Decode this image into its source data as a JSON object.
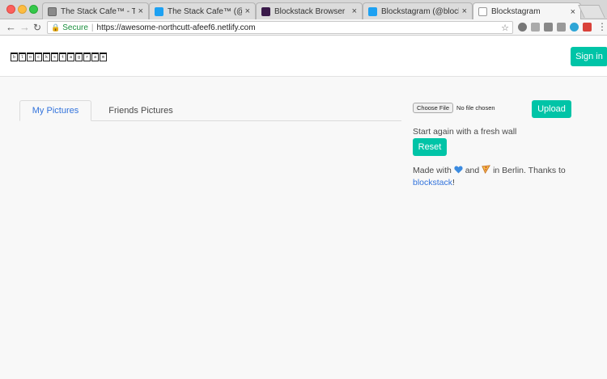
{
  "browser": {
    "tabs": [
      {
        "title": "The Stack Cafe™ - The Stac",
        "icon": "stack-cafe-icon"
      },
      {
        "title": "The Stack Cafe™ (@Grid_di",
        "icon": "twitter-icon"
      },
      {
        "title": "Blockstack Browser",
        "icon": "blockstack-icon"
      },
      {
        "title": "Blockstagram (@blockstagr",
        "icon": "twitter-icon"
      },
      {
        "title": "Blockstagram",
        "icon": "page-icon"
      }
    ],
    "close_glyph": "×",
    "address": {
      "secure_label": "Secure",
      "url": "https://awesome-northcutt-afeef6.netlify.com"
    }
  },
  "navbar": {
    "logo_text": "blockstagram",
    "signin_label": "Sign in"
  },
  "tabs": {
    "my_pictures": "My Pictures",
    "friends_pictures": "Friends Pictures"
  },
  "upload": {
    "choose_label": "Choose File",
    "no_file": "No file chosen",
    "upload_label": "Upload"
  },
  "reset": {
    "prompt": "Start again with a fresh wall",
    "button_label": "Reset"
  },
  "footer": {
    "made_with": "Made with",
    "and": "and",
    "in_berlin": "in Berlin. Thanks to",
    "link_text": "blockstack",
    "end": "!"
  },
  "colors": {
    "accent": "#00c4a7",
    "link": "#3273dc"
  }
}
